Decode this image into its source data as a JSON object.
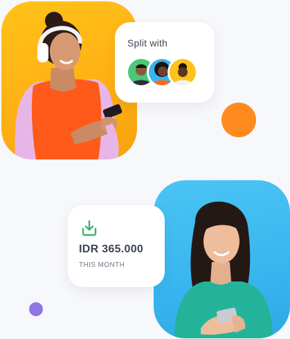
{
  "split_card": {
    "title": "Split with",
    "avatars": [
      {
        "icon": "person-avatar-1",
        "ring_color": "#4cc777"
      },
      {
        "icon": "person-avatar-2",
        "ring_color": "#38b6ef"
      },
      {
        "icon": "person-avatar-3",
        "ring_color": "#ffc21a"
      }
    ]
  },
  "amount_card": {
    "icon": "download-icon",
    "value": "IDR 365.000",
    "caption": "THIS MONTH",
    "accent_color": "#3cb46a"
  },
  "colors": {
    "yellow_card": "#ffb114",
    "blue_card": "#38b6ef",
    "orange_dot": "#ff8a1d",
    "purple_dot": "#8e76e6"
  }
}
